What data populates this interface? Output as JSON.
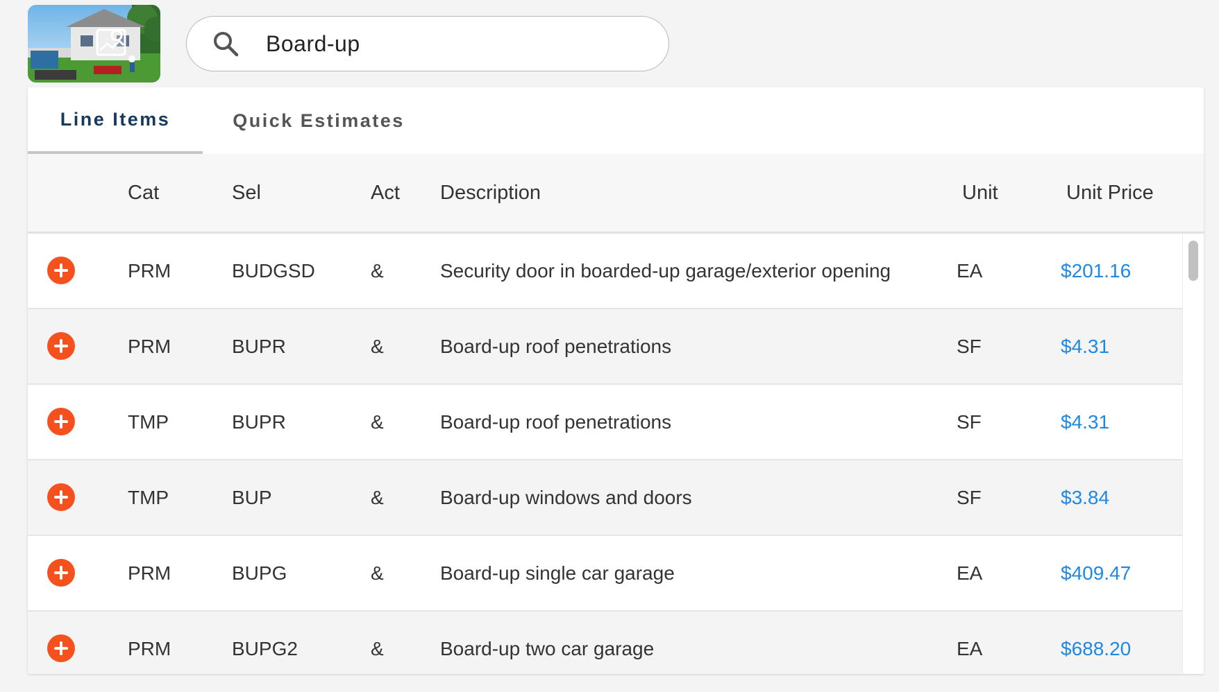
{
  "search": {
    "value": "Board-up",
    "icon": "search-icon"
  },
  "tabs": [
    {
      "label": "Line Items",
      "active": true
    },
    {
      "label": "Quick Estimates",
      "active": false
    }
  ],
  "table": {
    "columns": [
      "Cat",
      "Sel",
      "Act",
      "Description",
      "Unit",
      "Unit Price"
    ],
    "rows": [
      {
        "cat": "PRM",
        "sel": "BUDGSD",
        "act": "&",
        "description": "Security door in boarded-up garage/exterior opening",
        "unit": "EA",
        "price": "$201.16"
      },
      {
        "cat": "PRM",
        "sel": "BUPR",
        "act": "&",
        "description": "Board-up roof penetrations",
        "unit": "SF",
        "price": "$4.31"
      },
      {
        "cat": "TMP",
        "sel": "BUPR",
        "act": "&",
        "description": "Board-up roof penetrations",
        "unit": "SF",
        "price": "$4.31"
      },
      {
        "cat": "TMP",
        "sel": "BUP",
        "act": "&",
        "description": "Board-up windows and doors",
        "unit": "SF",
        "price": "$3.84"
      },
      {
        "cat": "PRM",
        "sel": "BUPG",
        "act": "&",
        "description": "Board-up single car garage",
        "unit": "EA",
        "price": "$409.47"
      },
      {
        "cat": "PRM",
        "sel": "BUPG2",
        "act": "&",
        "description": "Board-up two car garage",
        "unit": "EA",
        "price": "$688.20"
      }
    ]
  },
  "colors": {
    "accent_orange": "#f4511e",
    "price_blue": "#1e88e5",
    "tab_active": "#163a5f"
  }
}
